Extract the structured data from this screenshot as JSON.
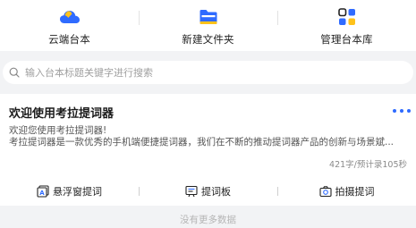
{
  "top_actions": [
    {
      "label": "云端台本",
      "icon": "cloud-icon"
    },
    {
      "label": "新建文件夹",
      "icon": "folder-icon"
    },
    {
      "label": "管理台本库",
      "icon": "grid-icon"
    }
  ],
  "search": {
    "placeholder": "输入台本标题关键字进行搜索"
  },
  "card": {
    "title": "欢迎使用考拉提词器",
    "body_line1": "欢迎您使用考拉提词器!",
    "body_line2": "考拉提词器是一款优秀的手机端便捷提词器，我们在不断的推动提词器产品的创新与场景斌...",
    "meta": "421字/预计录105秒",
    "actions": [
      {
        "label": "悬浮窗提词",
        "icon": "float-window-icon"
      },
      {
        "label": "提词板",
        "icon": "board-icon"
      },
      {
        "label": "拍摄提词",
        "icon": "camera-icon"
      }
    ]
  },
  "footer": {
    "text": "没有更多数据"
  },
  "colors": {
    "accent": "#2f6bff",
    "background": "#f2f3f5",
    "card": "#ffffff"
  }
}
